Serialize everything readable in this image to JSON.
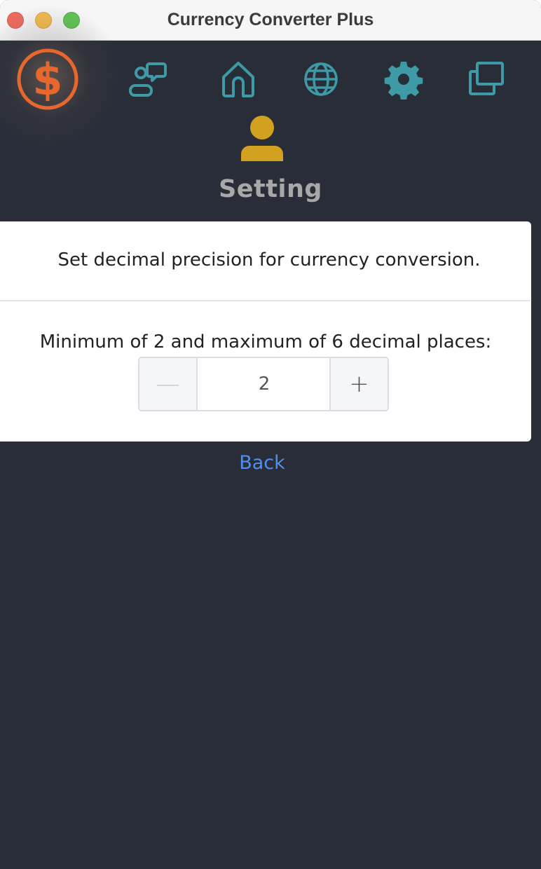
{
  "window": {
    "title": "Currency Converter Plus"
  },
  "nav": {
    "items": [
      {
        "icon": "chat-bubbles-icon"
      },
      {
        "icon": "home-icon"
      },
      {
        "icon": "globe-icon"
      },
      {
        "icon": "gear-icon"
      },
      {
        "icon": "windows-icon"
      }
    ],
    "accent_color": "#3d9aa6",
    "logo_color": "#e8672f",
    "profile_color": "#d1a11f"
  },
  "page": {
    "heading": "Setting"
  },
  "settings": {
    "description": "Set decimal precision for currency conversion.",
    "range_label": "Minimum of 2 and maximum of 6 decimal places:",
    "stepper": {
      "value": "2",
      "decrement_symbol": "—",
      "increment_symbol": "+"
    }
  },
  "actions": {
    "back_label": "Back"
  }
}
